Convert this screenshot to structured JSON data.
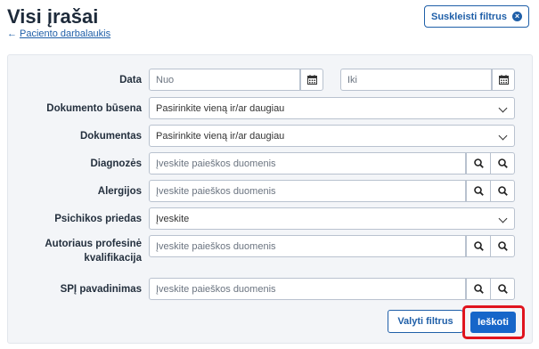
{
  "header": {
    "title": "Visi įrašai",
    "back_link_arrow": "←",
    "back_link": "Paciento darbalaukis",
    "collapse_filters": "Suskleisti filtrus",
    "collapse_icon": "close-circle-icon"
  },
  "filters": {
    "date": {
      "label": "Data",
      "from_placeholder": "Nuo",
      "to_placeholder": "Iki"
    },
    "document_status": {
      "label": "Dokumento būsena",
      "value": "Pasirinkite vieną ir/ar daugiau"
    },
    "document": {
      "label": "Dokumentas",
      "value": "Pasirinkite vieną ir/ar daugiau"
    },
    "diagnoses": {
      "label": "Diagnozės",
      "placeholder": "Įveskite paieškos duomenis"
    },
    "allergies": {
      "label": "Alergijos",
      "placeholder": "Įveskite paieškos duomenis"
    },
    "psych_appendix": {
      "label": "Psichikos priedas",
      "value": "Įveskite"
    },
    "author_qualification": {
      "label": "Autoriaus profesinė kvalifikacija",
      "placeholder": "Įveskite paieškos duomenis"
    },
    "spi_name": {
      "label": "SPĮ pavadinimas",
      "placeholder": "Įveskite paieškos duomenis"
    }
  },
  "actions": {
    "clear": "Valyti filtrus",
    "search": "Ieškoti"
  },
  "colors": {
    "accent": "#1f5fa8",
    "primary_button": "#1666c9",
    "highlight_border": "#e0141e",
    "panel_bg": "#f3f5f8"
  }
}
